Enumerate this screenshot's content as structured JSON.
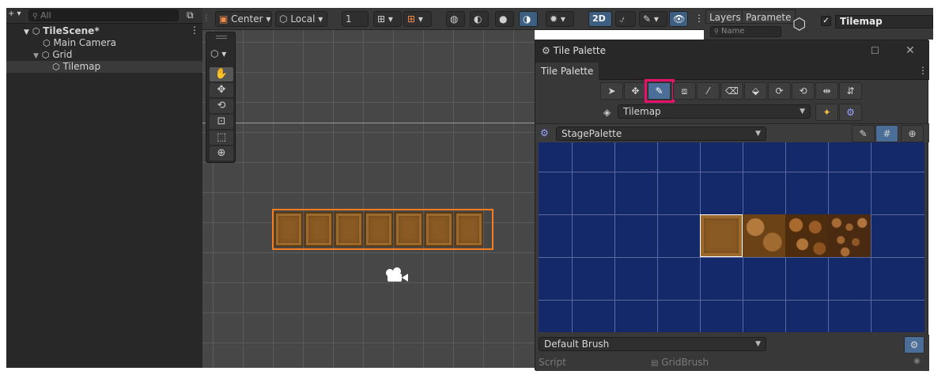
{
  "hierarchy": {
    "search_placeholder": "All",
    "scene_name": "TileScene*",
    "items": [
      {
        "label": "Main Camera"
      },
      {
        "label": "Grid"
      },
      {
        "label": "Tilemap"
      }
    ]
  },
  "scene_toolbar": {
    "pivot_mode": "Center",
    "pivot_rotation": "Local",
    "grid_snap_value": "1",
    "mode_2d": "2D"
  },
  "inspector": {
    "tabs": [
      "Layers",
      "Paramete"
    ],
    "search_placeholder": "Name",
    "object_name": "Tilemap"
  },
  "tile_palette": {
    "window_title": "Tile Palette",
    "tab_label": "Tile Palette",
    "active_target": "Tilemap",
    "palette_name": "StagePalette",
    "brush": "Default Brush",
    "script_label": "Script",
    "script_value": "GridBrush",
    "tools": [
      "select-icon",
      "move-icon",
      "paint-brush-icon",
      "box-fill-icon",
      "picker-icon",
      "eraser-icon",
      "fill-icon",
      "rotate-cw-icon",
      "rotate-ccw-icon",
      "flip-x-icon",
      "flip-y-icon"
    ]
  },
  "colors": {
    "accent_highlight": "#e8106a",
    "selection_outline": "#f57c1f",
    "palette_bg": "#14296a"
  }
}
